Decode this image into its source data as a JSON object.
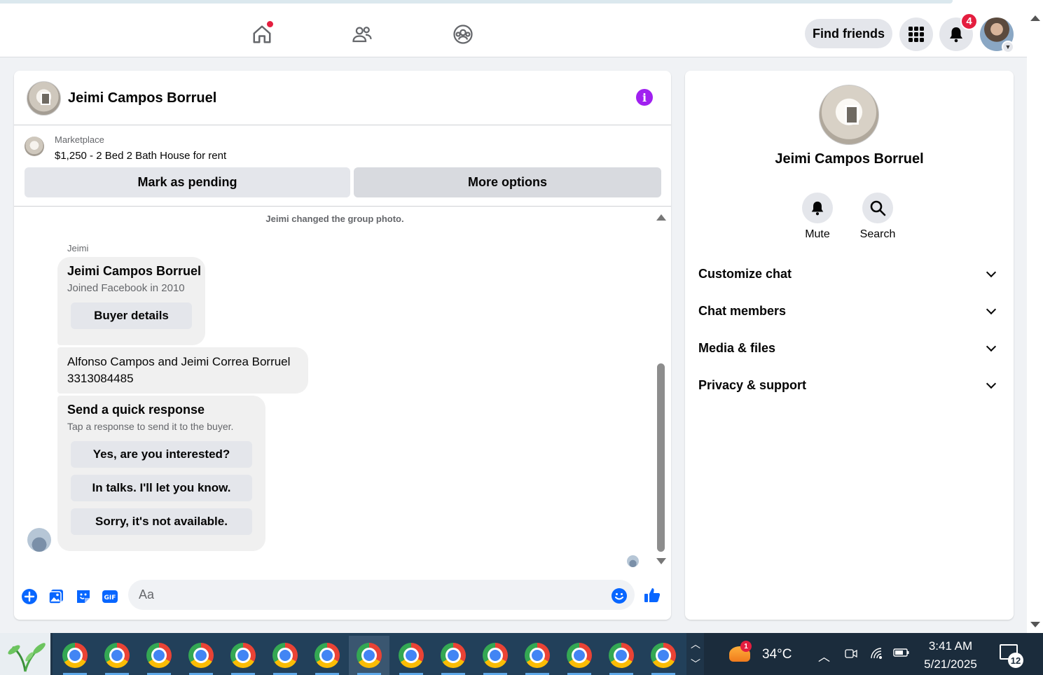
{
  "header": {
    "find_friends_label": "Find friends",
    "notification_count": "4",
    "nav": [
      "home-icon",
      "friends-icon",
      "groups-icon"
    ]
  },
  "chat": {
    "contact_name": "Jeimi Campos Borruel",
    "marketplace_label": "Marketplace",
    "listing_title": "$1,250 - 2 Bed 2 Bath House for rent",
    "mark_pending_label": "Mark as pending",
    "more_options_label": "More options",
    "system_message": "Jeimi changed the group photo.",
    "sender_name": "Jeimi",
    "card1": {
      "title": "Jeimi Campos Borruel",
      "subtitle": "Joined Facebook in 2010",
      "button": "Buyer details"
    },
    "card2": {
      "line1": "Alfonso Campos and Jeimi Correa Borruel",
      "line2": "3313084485"
    },
    "card3": {
      "title": "Send a quick response",
      "subtitle": "Tap a response to send it to the buyer.",
      "responses": [
        "Yes, are you interested?",
        "In talks. I'll let you know.",
        "Sorry, it's not available."
      ]
    },
    "composer_placeholder": "Aa"
  },
  "info_panel": {
    "name": "Jeimi Campos Borruel",
    "actions": [
      {
        "label": "Mute",
        "icon": "bell-icon"
      },
      {
        "label": "Search",
        "icon": "search-icon"
      }
    ],
    "sections": [
      "Customize chat",
      "Chat members",
      "Media & files",
      "Privacy & support"
    ]
  },
  "taskbar": {
    "weather_badge": "1",
    "temperature": "34°C",
    "time": "3:41 AM",
    "date": "5/21/2025",
    "notification_count": "12"
  },
  "colors": {
    "accent_blue": "#0866ff",
    "info_purple": "#a020f0",
    "badge_red": "#e41e3f"
  }
}
